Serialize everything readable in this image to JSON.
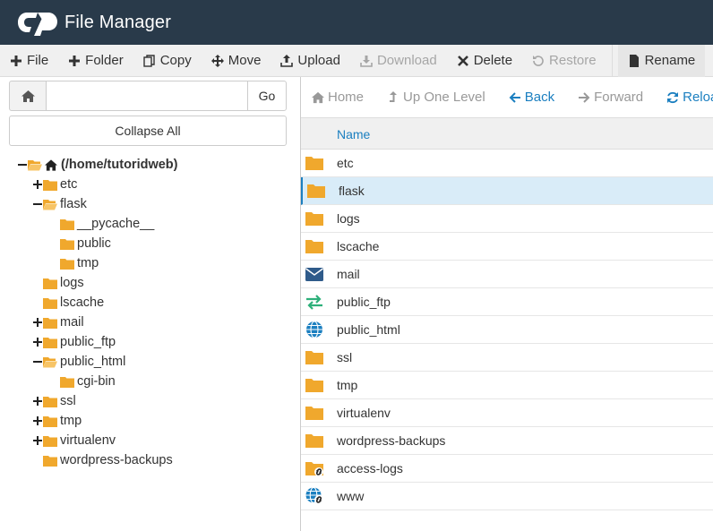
{
  "header": {
    "title": "File Manager"
  },
  "toolbar": {
    "file": "File",
    "folder": "Folder",
    "copy": "Copy",
    "move": "Move",
    "upload": "Upload",
    "download": "Download",
    "delete": "Delete",
    "restore": "Restore",
    "rename": "Rename"
  },
  "sidebar": {
    "path_value": "",
    "go_label": "Go",
    "collapse_label": "Collapse All",
    "root_label": "(/home/tutoridweb)",
    "tree": [
      {
        "label": "etc",
        "level": 1,
        "toggle": "plus",
        "open": false
      },
      {
        "label": "flask",
        "level": 1,
        "toggle": "minus",
        "open": true
      },
      {
        "label": "__pycache__",
        "level": 2,
        "toggle": "none",
        "open": false
      },
      {
        "label": "public",
        "level": 2,
        "toggle": "none",
        "open": false
      },
      {
        "label": "tmp",
        "level": 2,
        "toggle": "none",
        "open": false
      },
      {
        "label": "logs",
        "level": 1,
        "toggle": "none",
        "open": false
      },
      {
        "label": "lscache",
        "level": 1,
        "toggle": "none",
        "open": false
      },
      {
        "label": "mail",
        "level": 1,
        "toggle": "plus",
        "open": false
      },
      {
        "label": "public_ftp",
        "level": 1,
        "toggle": "plus",
        "open": false
      },
      {
        "label": "public_html",
        "level": 1,
        "toggle": "minus",
        "open": true
      },
      {
        "label": "cgi-bin",
        "level": 2,
        "toggle": "none",
        "open": false
      },
      {
        "label": "ssl",
        "level": 1,
        "toggle": "plus",
        "open": false
      },
      {
        "label": "tmp",
        "level": 1,
        "toggle": "plus",
        "open": false
      },
      {
        "label": "virtualenv",
        "level": 1,
        "toggle": "plus",
        "open": false
      },
      {
        "label": "wordpress-backups",
        "level": 1,
        "toggle": "none",
        "open": false
      }
    ]
  },
  "nav": {
    "home": "Home",
    "up": "Up One Level",
    "back": "Back",
    "forward": "Forward",
    "reload": "Reload"
  },
  "list": {
    "name_header": "Name",
    "files": [
      {
        "name": "etc",
        "icon": "folder-icon"
      },
      {
        "name": "flask",
        "icon": "folder-icon",
        "selected": true
      },
      {
        "name": "logs",
        "icon": "folder-icon"
      },
      {
        "name": "lscache",
        "icon": "folder-icon"
      },
      {
        "name": "mail",
        "icon": "mail-icon"
      },
      {
        "name": "public_ftp",
        "icon": "transfer-icon"
      },
      {
        "name": "public_html",
        "icon": "globe-icon"
      },
      {
        "name": "ssl",
        "icon": "folder-icon"
      },
      {
        "name": "tmp",
        "icon": "folder-icon"
      },
      {
        "name": "virtualenv",
        "icon": "folder-icon"
      },
      {
        "name": "wordpress-backups",
        "icon": "folder-icon"
      },
      {
        "name": "access-logs",
        "icon": "folder-link-icon"
      },
      {
        "name": "www",
        "icon": "globe-link-icon"
      }
    ]
  },
  "colors": {
    "header_bg": "#293a4a",
    "accent": "#1b7fc0",
    "folder": "#f0a82d",
    "selected_row": "#d9ecf8"
  }
}
